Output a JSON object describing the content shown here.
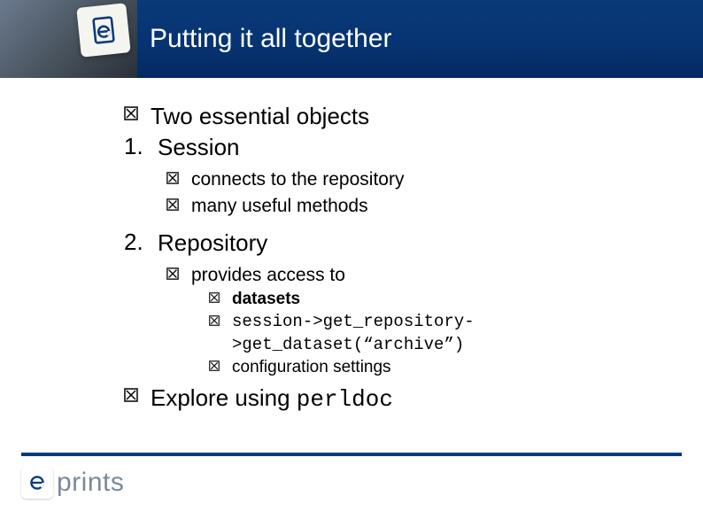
{
  "header": {
    "title": "Putting it all together"
  },
  "bullets": {
    "lvl1_a": "Two essential objects",
    "num1": "1.",
    "item1": "Session",
    "s1a": "connects to the repository",
    "s1b": "many useful methods",
    "num2": "2.",
    "item2": "Repository",
    "s2a": "provides access to",
    "s2a1": "datasets",
    "s2a2": "session->get_repository->get_dataset(“archive”)",
    "s2a3": "configuration settings",
    "lvl1_b_prefix": "Explore using ",
    "lvl1_b_code": "perldoc"
  },
  "footer": {
    "logo_text": "prints"
  }
}
